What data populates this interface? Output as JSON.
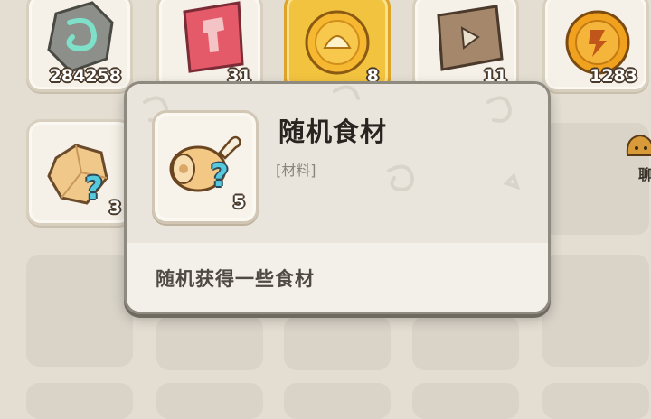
{
  "inventory": {
    "row1": [
      {
        "name": "stone-rune",
        "icon": "swirl-stone-icon",
        "count": "284258"
      },
      {
        "name": "red-ticket",
        "icon": "hammer-ticket-icon",
        "count": "31"
      },
      {
        "name": "shell-coin",
        "icon": "shell-coin-icon",
        "count": "8",
        "selected": true
      },
      {
        "name": "play-ticket",
        "icon": "play-ticket-icon",
        "count": "11"
      },
      {
        "name": "gold-coin",
        "icon": "gold-coin-icon",
        "count": "1283"
      }
    ],
    "row2": [
      {
        "name": "mystery-gem",
        "icon": "gem-question-icon",
        "count": "3"
      }
    ]
  },
  "tooltip": {
    "title": "随机食材",
    "category": "[材料]",
    "count": "5",
    "description": "随机获得一些食材",
    "icon": "meat-question-icon"
  },
  "side_label": "聊",
  "colors": {
    "background": "#e4ded2",
    "selected_slot": "#f2c33e",
    "question_mark": "#57c9dc"
  }
}
